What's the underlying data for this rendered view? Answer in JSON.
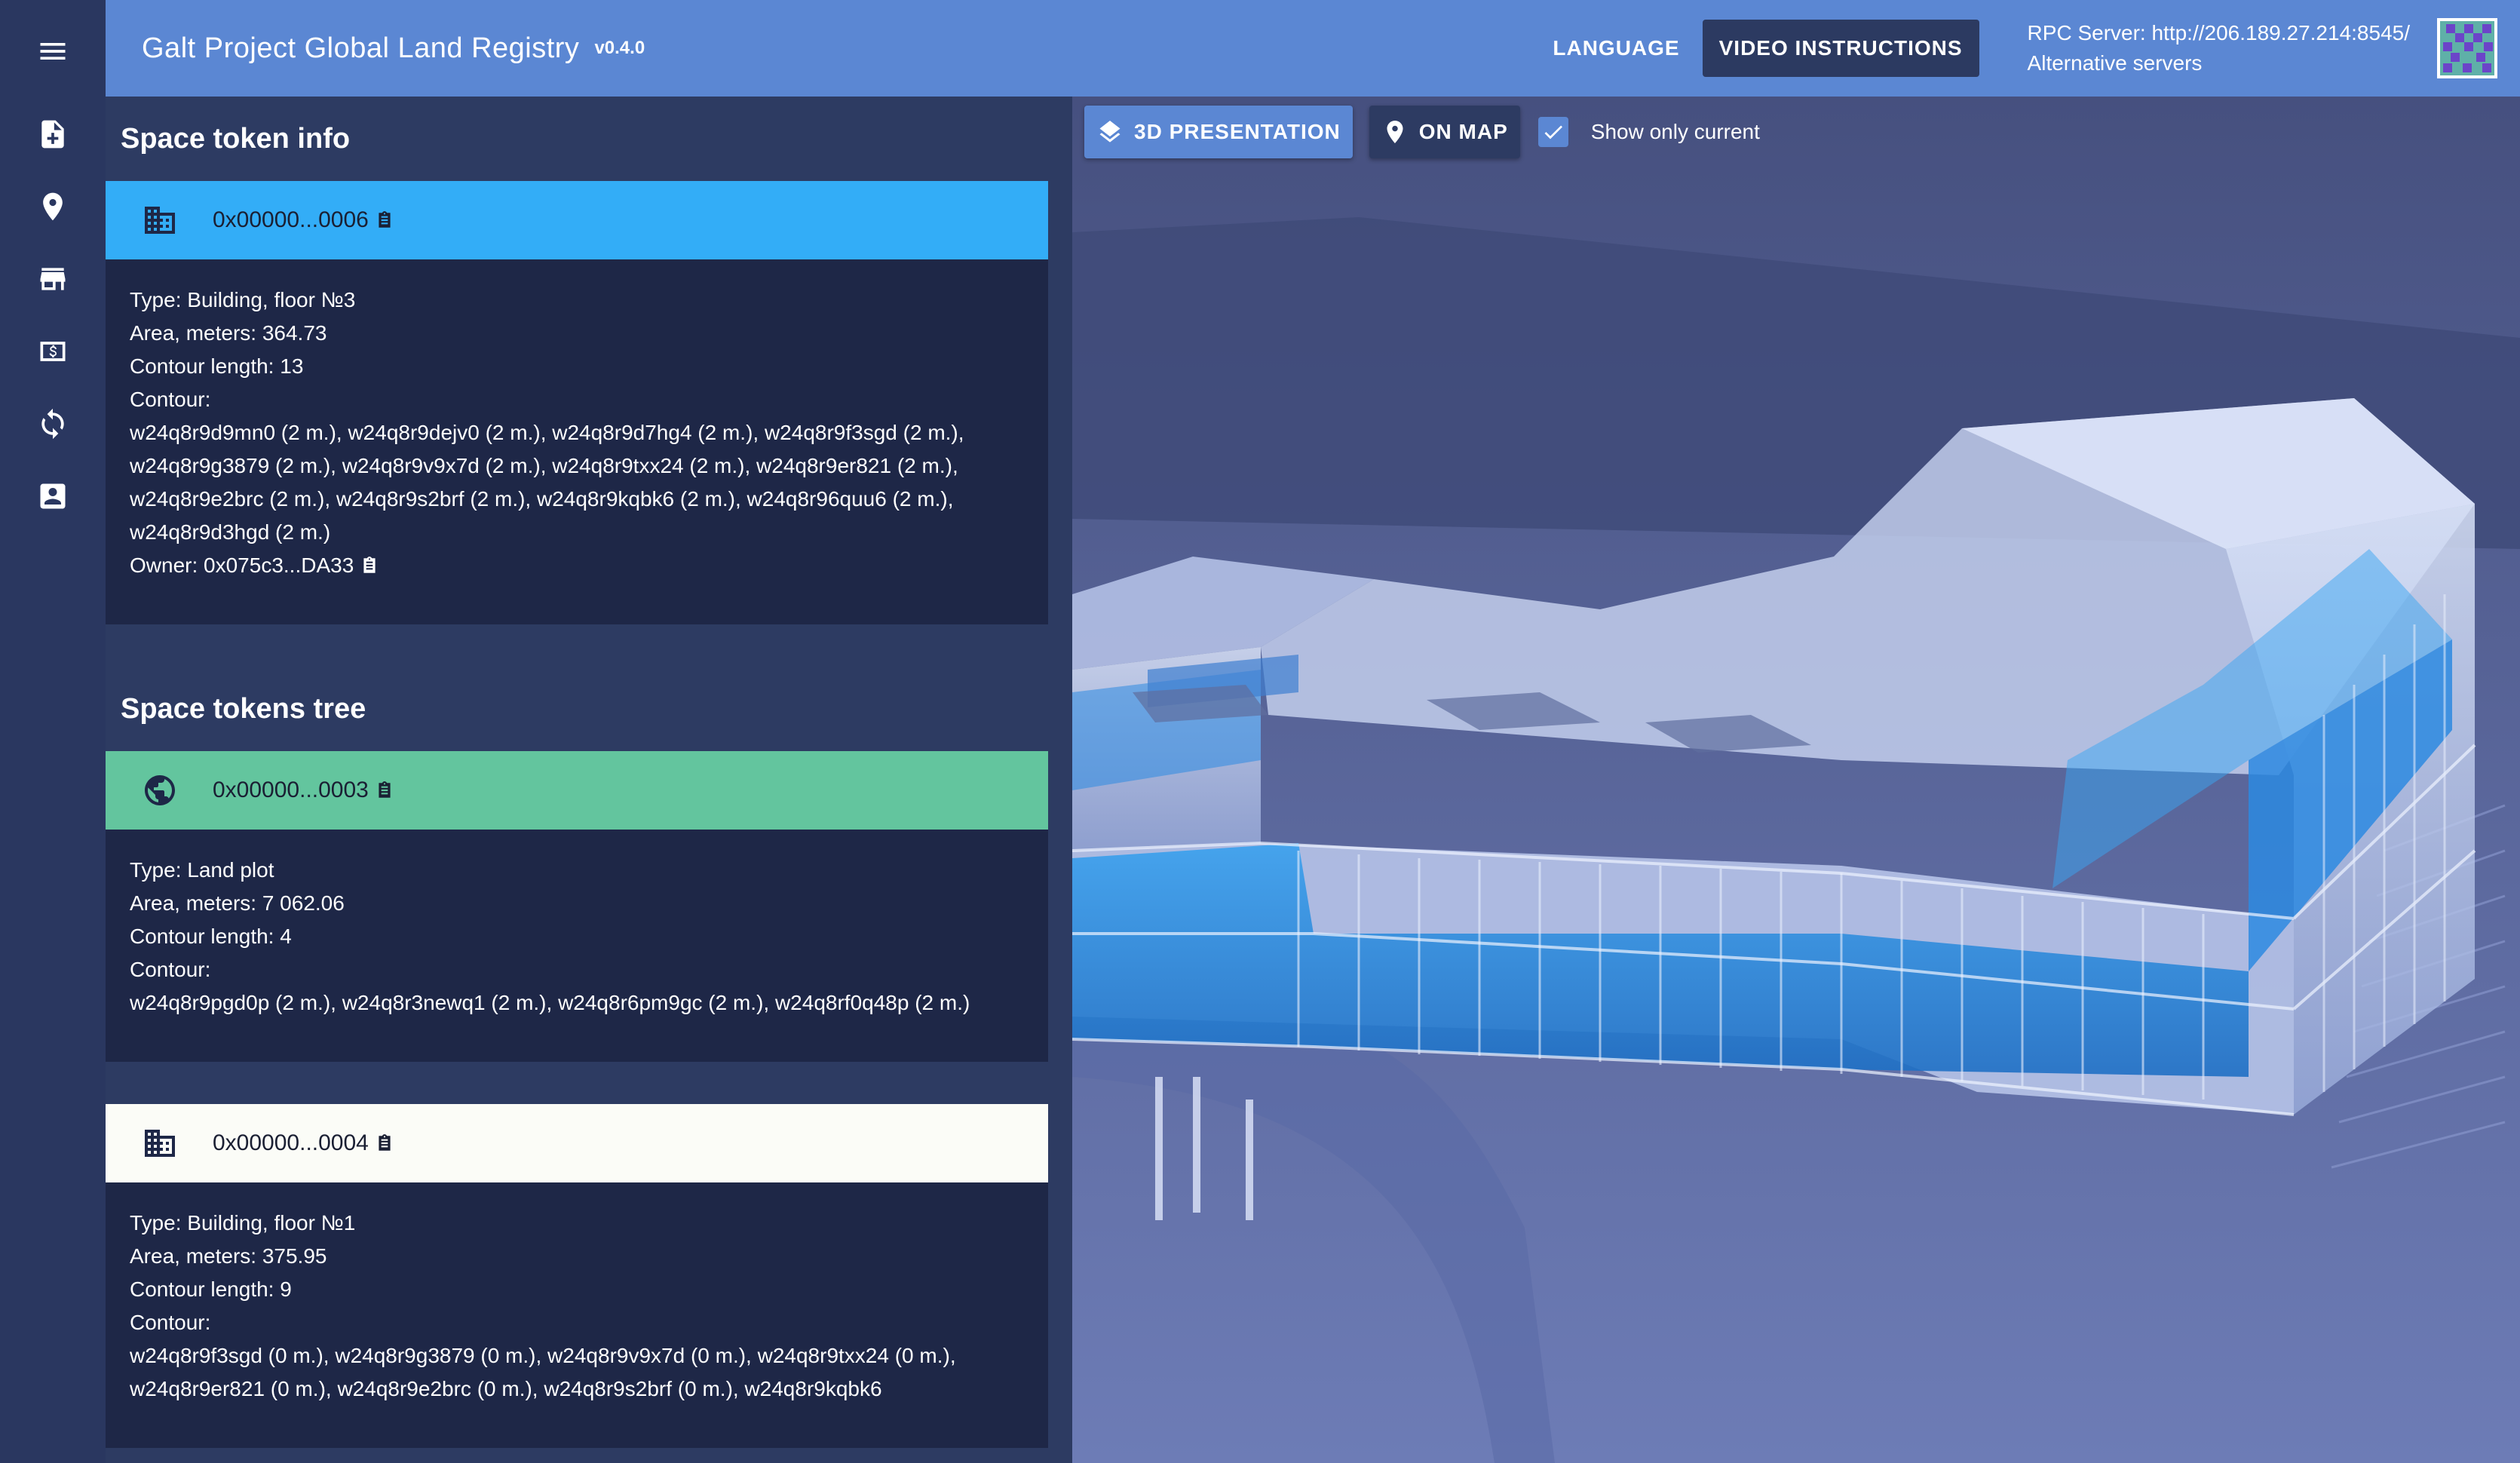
{
  "app": {
    "title": "Galt Project Global Land Registry",
    "version": "v0.4.0"
  },
  "topbar": {
    "language_label": "LANGUAGE",
    "video_label": "VIDEO INSTRUCTIONS",
    "rpc_server": "RPC Server: http://206.189.27.214:8545/",
    "alt_servers": "Alternative servers"
  },
  "sidebar": {
    "items": [
      {
        "icon": "add-document-icon"
      },
      {
        "icon": "map-pin-icon"
      },
      {
        "icon": "store-icon"
      },
      {
        "icon": "money-icon"
      },
      {
        "icon": "sync-icon"
      },
      {
        "icon": "account-box-icon"
      }
    ]
  },
  "info": {
    "section_title": "Space token info",
    "token": {
      "id": "0x00000...0006",
      "type": "Type: Building, floor №3",
      "area": "Area, meters: 364.73",
      "contour_length": "Contour length: 13",
      "contour_label": "Contour:",
      "contour": "w24q8r9d9mn0 (2 m.), w24q8r9dejv0 (2 m.), w24q8r9d7hg4 (2 m.), w24q8r9f3sgd (2 m.), w24q8r9g3879 (2 m.), w24q8r9v9x7d (2 m.), w24q8r9txx24 (2 m.), w24q8r9er821 (2 m.), w24q8r9e2brc (2 m.), w24q8r9s2brf (2 m.), w24q8r9kqbk6 (2 m.), w24q8r96quu6 (2 m.), w24q8r9d3hgd (2 m.)",
      "owner": "Owner: 0x075c3...DA33"
    }
  },
  "tree": {
    "section_title": "Space tokens tree",
    "nodes": [
      {
        "id": "0x00000...0003",
        "type": "Type: Land plot",
        "area": "Area, meters: 7 062.06",
        "contour_length": "Contour length: 4",
        "contour_label": "Contour:",
        "contour": "w24q8r9pgd0p (2 m.), w24q8r3newq1 (2 m.), w24q8r6pm9gc (2 m.), w24q8rf0q48p (2 m.)"
      },
      {
        "id": "0x00000...0004",
        "type": "Type: Building, floor №1",
        "area": "Area, meters: 375.95",
        "contour_length": "Contour length: 9",
        "contour_label": "Contour:",
        "contour": "w24q8r9f3sgd (0 m.), w24q8r9g3879 (0 m.), w24q8r9v9x7d (0 m.), w24q8r9txx24 (0 m.), w24q8r9er821 (0 m.), w24q8r9e2brc (0 m.), w24q8r9s2brf (0 m.), w24q8r9kqbk6"
      }
    ]
  },
  "viewer": {
    "btn_3d": "3D PRESENTATION",
    "btn_map": "ON MAP",
    "show_only_current": "Show only current",
    "show_only_current_checked": true
  },
  "colors": {
    "topbar": "#5b87d3",
    "sidebar": "#2a3760",
    "card": "#1e2747",
    "header_selected": "#33adf7",
    "header_land": "#63c59e",
    "header_building": "#fbfcf7"
  }
}
